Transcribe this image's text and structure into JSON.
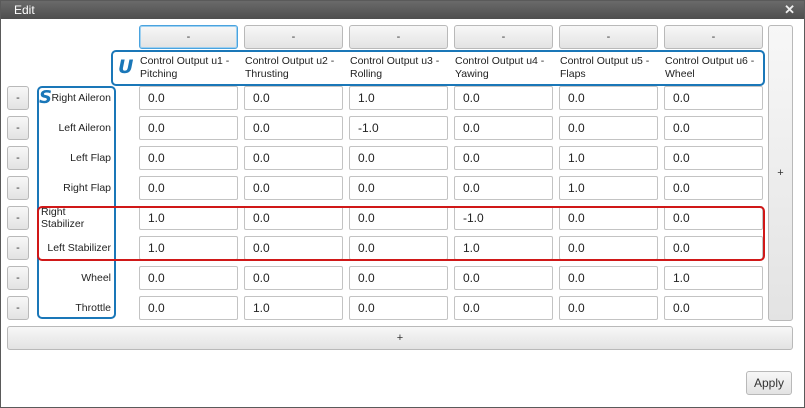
{
  "window": {
    "title": "Edit",
    "close_glyph": "✕"
  },
  "column_remove_label": "-",
  "row_remove_label": "-",
  "add_column_label": "+",
  "add_row_label": "+",
  "apply_label": "Apply",
  "overlay_letters": {
    "u": "U",
    "s": "S"
  },
  "columns": [
    "Control Output u1 - Pitching",
    "Control Output u2 - Thrusting",
    "Control Output u3 - Rolling",
    "Control Output u4 - Yawing",
    "Control Output u5 - Flaps",
    "Control Output u6 - Wheel"
  ],
  "rows": [
    {
      "label": "Right Aileron",
      "values": [
        "0.0",
        "0.0",
        "1.0",
        "0.0",
        "0.0",
        "0.0"
      ]
    },
    {
      "label": "Left Aileron",
      "values": [
        "0.0",
        "0.0",
        "-1.0",
        "0.0",
        "0.0",
        "0.0"
      ]
    },
    {
      "label": "Left Flap",
      "values": [
        "0.0",
        "0.0",
        "0.0",
        "0.0",
        "1.0",
        "0.0"
      ]
    },
    {
      "label": "Right Flap",
      "values": [
        "0.0",
        "0.0",
        "0.0",
        "0.0",
        "1.0",
        "0.0"
      ]
    },
    {
      "label": "Right Stabilizer",
      "values": [
        "1.0",
        "0.0",
        "0.0",
        "-1.0",
        "0.0",
        "0.0"
      ]
    },
    {
      "label": "Left Stabilizer",
      "values": [
        "1.0",
        "0.0",
        "0.0",
        "1.0",
        "0.0",
        "0.0"
      ]
    },
    {
      "label": "Wheel",
      "values": [
        "0.0",
        "0.0",
        "0.0",
        "0.0",
        "0.0",
        "1.0"
      ]
    },
    {
      "label": "Throttle",
      "values": [
        "0.0",
        "1.0",
        "0.0",
        "0.0",
        "0.0",
        "0.0"
      ]
    }
  ],
  "annotation_colors": {
    "blue": "#1a77b8",
    "red": "#d01818"
  }
}
